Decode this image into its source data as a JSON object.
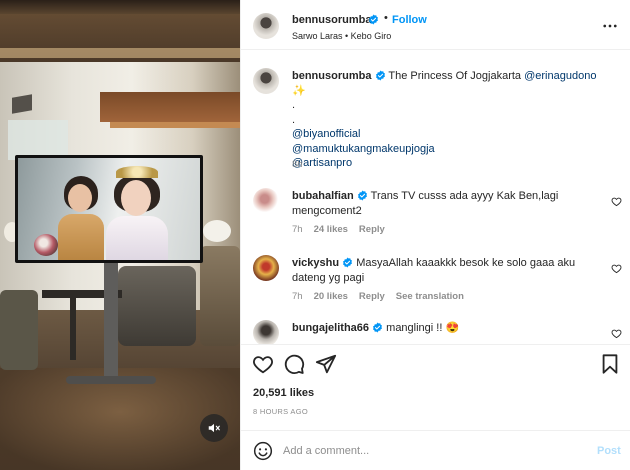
{
  "post": {
    "username": "bennusorumba",
    "follow_label": "Follow",
    "separator": "•",
    "location": "Sarwo Laras • Kebo Giro",
    "caption": {
      "text": "The Princess Of Jogjakarta",
      "mention_main": "@erinagudono",
      "sparkle": "✨",
      "dot1": ".",
      "dot2": ".",
      "mentions": [
        "@biyanofficial",
        "@mamuktukangmakeupjogja",
        "@artisanpro"
      ],
      "time": "8h"
    }
  },
  "comments": [
    {
      "username": "bubahalfian",
      "text_line1": "Trans TV cusss ada ayyy Kak Ben,lagi",
      "text_line2": "mengcoment2",
      "time": "7h",
      "likes": "24 likes",
      "reply": "Reply"
    },
    {
      "username": "vickyshu",
      "text_line1": "MasyaAllah kaaakkk besok ke solo gaaa aku",
      "text_line2": "dateng yg pagi",
      "time": "7h",
      "likes": "20 likes",
      "reply": "Reply",
      "translate": "See translation"
    },
    {
      "username": "bungajelitha66",
      "text_line1": "manglingi !! 😍"
    }
  ],
  "actions": {
    "likes": "20,591 likes",
    "posted": "8 HOURS AGO"
  },
  "composer": {
    "placeholder": "Add a comment...",
    "post_label": "Post"
  },
  "colors": {
    "accent": "#0095f6",
    "link": "#00376b",
    "muted": "#8e8e8e",
    "post_disabled": "#b2dffc",
    "verified": "#0095f6"
  },
  "icons": [
    "verified-icon",
    "more-options-icon",
    "heart-icon",
    "comment-icon",
    "share-icon",
    "bookmark-icon",
    "emoji-icon",
    "mute-icon"
  ]
}
